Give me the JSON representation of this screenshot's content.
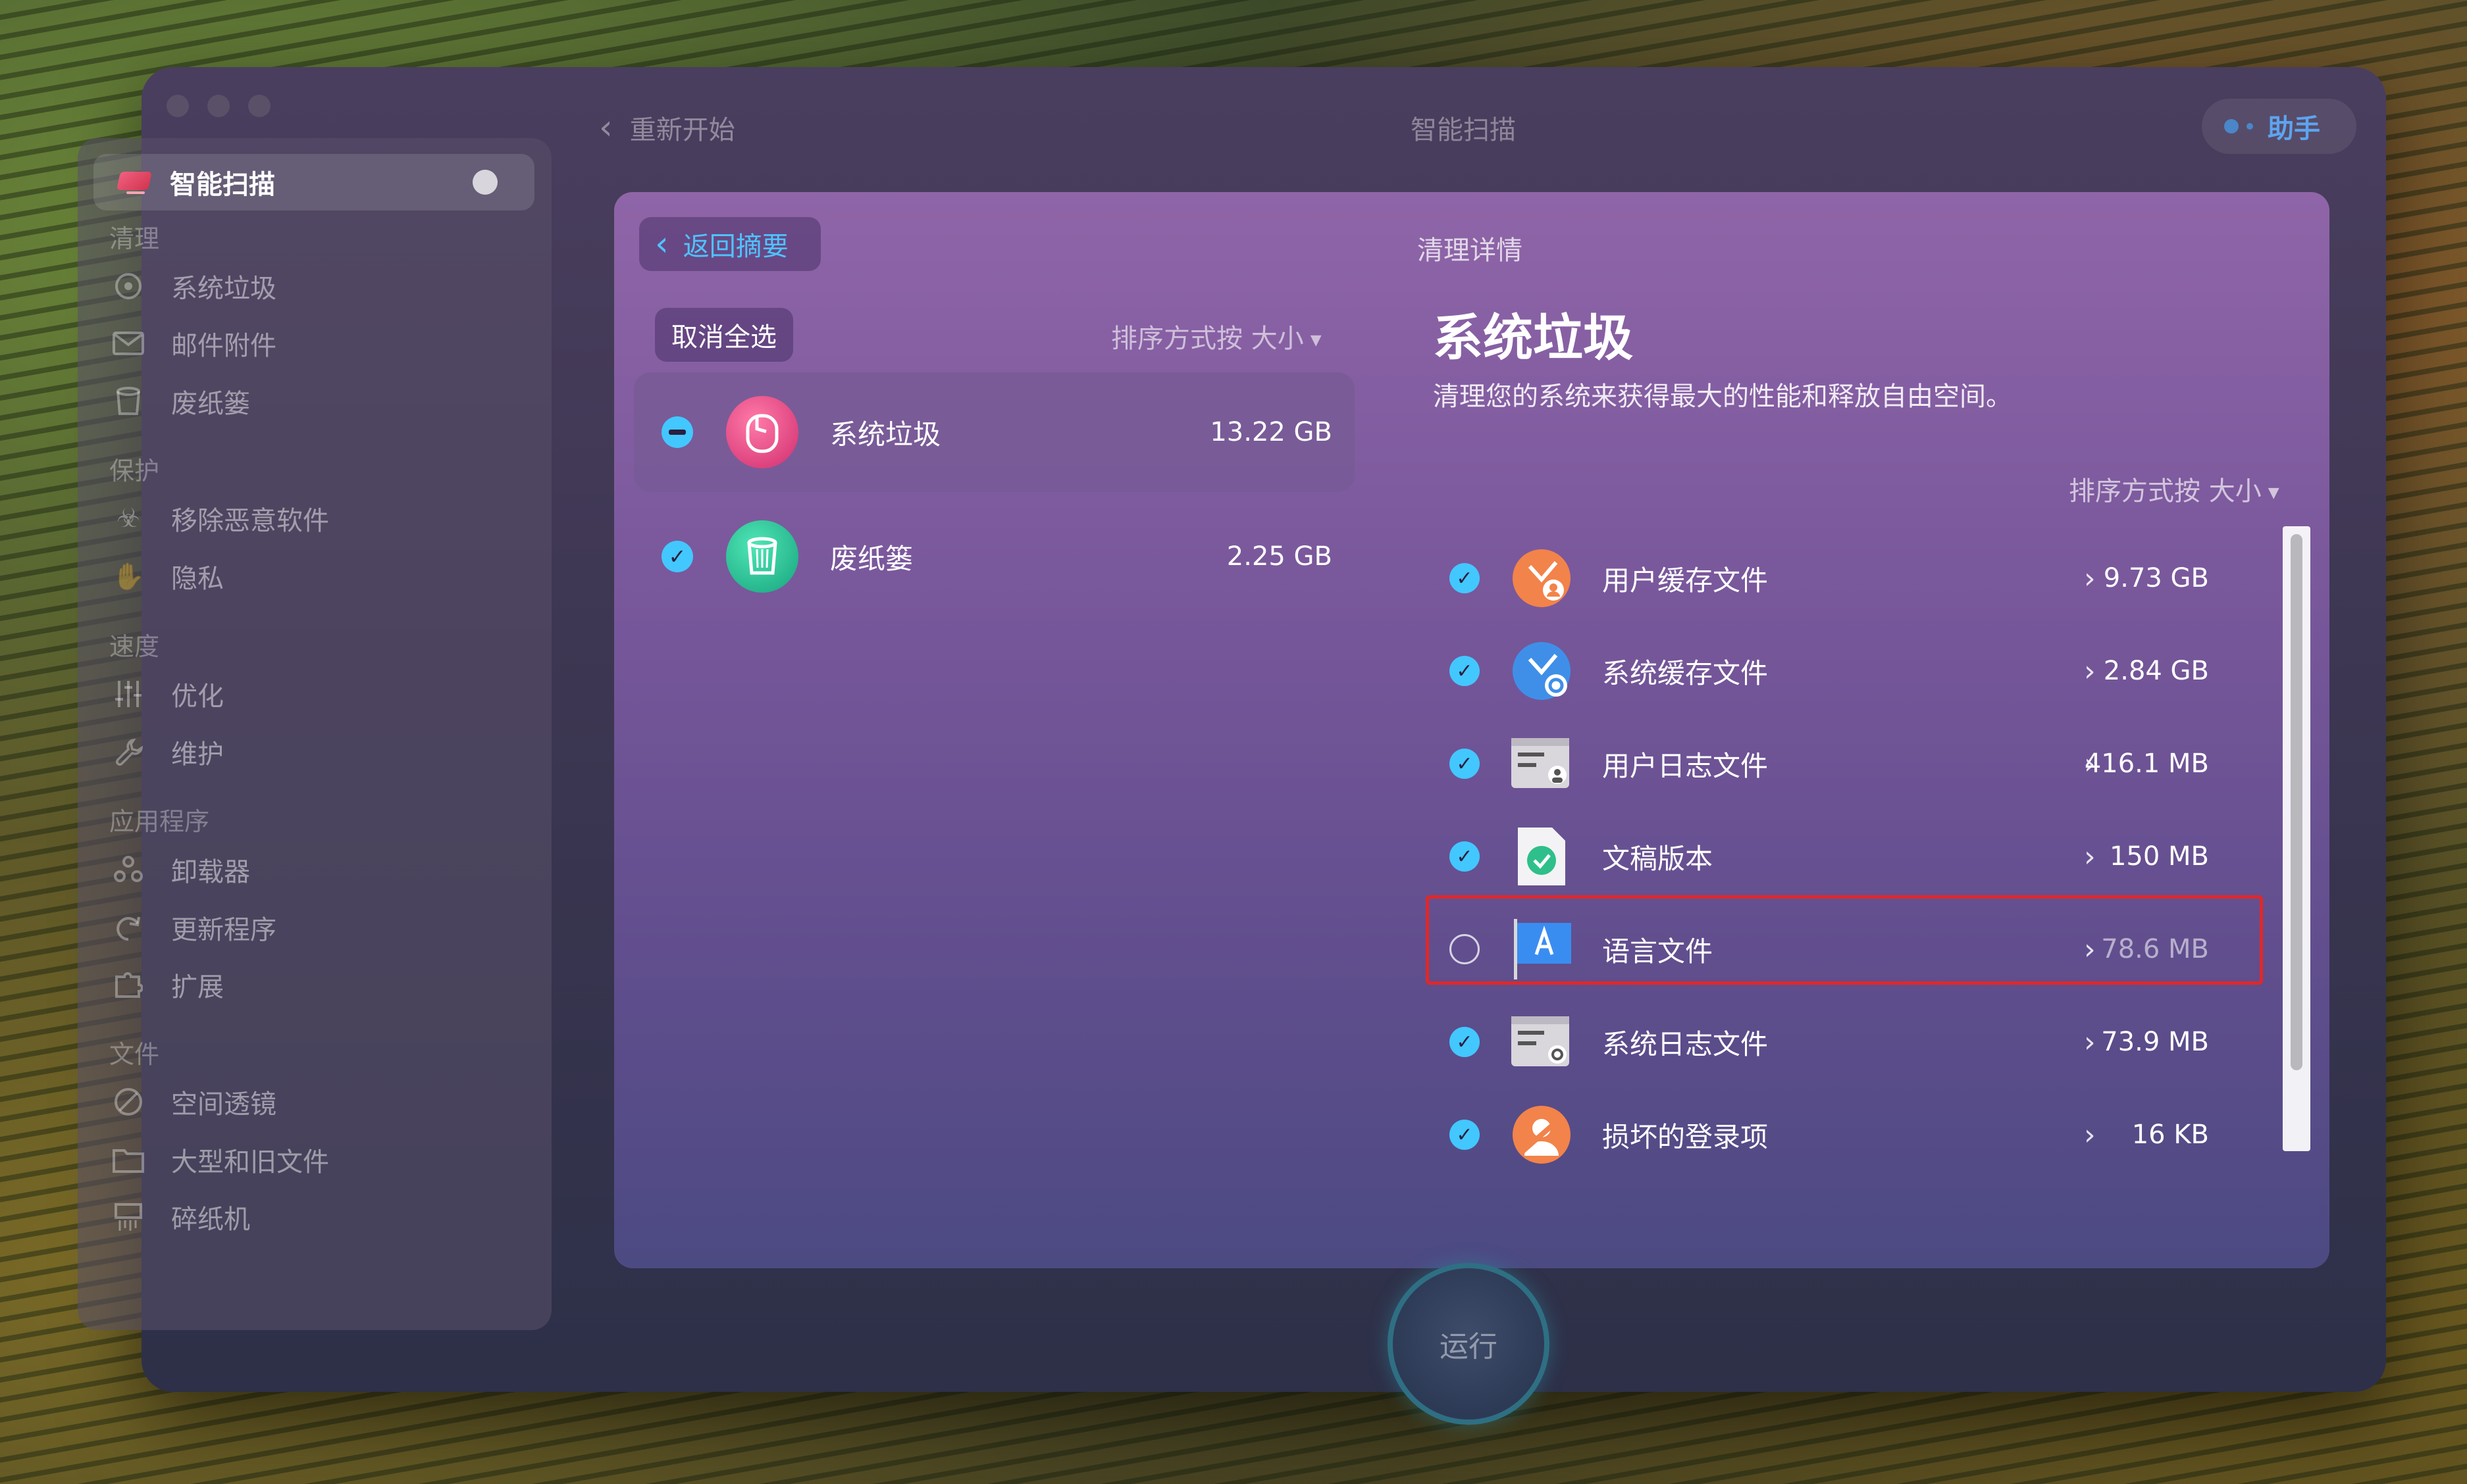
{
  "window": {
    "back_label": "重新开始",
    "title": "智能扫描",
    "assistant_label": "助手"
  },
  "sidebar": {
    "active_label": "智能扫描",
    "sections": [
      {
        "title": "清理",
        "items": [
          {
            "label": "系统垃圾",
            "icon": "drive-icon"
          },
          {
            "label": "邮件附件",
            "icon": "mail-icon"
          },
          {
            "label": "废纸篓",
            "icon": "trash-icon"
          }
        ]
      },
      {
        "title": "保护",
        "items": [
          {
            "label": "移除恶意软件",
            "icon": "biohazard-icon"
          },
          {
            "label": "隐私",
            "icon": "hand-icon"
          }
        ]
      },
      {
        "title": "速度",
        "items": [
          {
            "label": "优化",
            "icon": "sliders-icon"
          },
          {
            "label": "维护",
            "icon": "wrench-icon"
          }
        ]
      },
      {
        "title": "应用程序",
        "items": [
          {
            "label": "卸载器",
            "icon": "uninstaller-icon"
          },
          {
            "label": "更新程序",
            "icon": "updater-icon"
          },
          {
            "label": "扩展",
            "icon": "puzzle-icon"
          }
        ]
      },
      {
        "title": "文件",
        "items": [
          {
            "label": "空间透镜",
            "icon": "lens-icon"
          },
          {
            "label": "大型和旧文件",
            "icon": "folder-icon"
          },
          {
            "label": "碎纸机",
            "icon": "shredder-icon"
          }
        ]
      }
    ]
  },
  "left_pane": {
    "back_summary_label": "返回摘要",
    "deselect_all_label": "取消全选",
    "sort_label": "排序方式按 大小",
    "categories": [
      {
        "name": "系统垃圾",
        "size": "13.22 GB",
        "state": "partial",
        "icon": "system-junk-icon"
      },
      {
        "name": "废纸篓",
        "size": "2.25 GB",
        "state": "checked",
        "icon": "trash-bin-icon"
      }
    ]
  },
  "detail": {
    "subtitle": "清理详情",
    "title": "系统垃圾",
    "description": "清理您的系统来获得最大的性能和释放自由空间。",
    "sort_label": "排序方式按 大小",
    "items": [
      {
        "name": "用户缓存文件",
        "size": "9.73 GB",
        "checked": true,
        "icon": "user-cache-icon"
      },
      {
        "name": "系统缓存文件",
        "size": "2.84 GB",
        "checked": true,
        "icon": "system-cache-icon"
      },
      {
        "name": "用户日志文件",
        "size": "416.1 MB",
        "checked": true,
        "icon": "user-log-icon"
      },
      {
        "name": "文稿版本",
        "size": "150 MB",
        "checked": true,
        "icon": "document-versions-icon"
      },
      {
        "name": "语言文件",
        "size": "78.6 MB",
        "checked": false,
        "icon": "language-files-icon"
      },
      {
        "name": "系统日志文件",
        "size": "73.9 MB",
        "checked": true,
        "icon": "system-log-icon"
      },
      {
        "name": "损坏的登录项",
        "size": "16 KB",
        "checked": true,
        "icon": "broken-login-icon"
      }
    ]
  },
  "run_button_label": "运行",
  "colors": {
    "accent": "#43c7ff",
    "highlight_border": "#e0282a",
    "link": "#4ec3ff"
  }
}
